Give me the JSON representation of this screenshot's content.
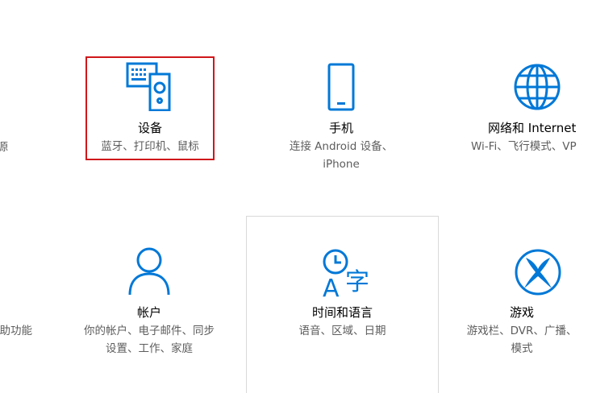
{
  "accent_color": "#0078d7",
  "highlight_color": "#d0171b",
  "tiles": {
    "left_partial_1": {
      "desc_line1": "源"
    },
    "devices": {
      "icon": "devices-icon",
      "title": "设备",
      "desc_line1": "蓝牙、打印机、鼠标"
    },
    "phone": {
      "icon": "phone-icon",
      "title": "手机",
      "desc_line1": "连接 Android 设备、",
      "desc_line2": "iPhone"
    },
    "network": {
      "icon": "globe-icon",
      "title": "网络和 Internet",
      "desc_line1": "Wi-Fi、飞行模式、VP"
    },
    "left_partial_2": {
      "desc_line1": "助功能"
    },
    "accounts": {
      "icon": "person-icon",
      "title": "帐户",
      "desc_line1": "你的帐户、电子邮件、同步",
      "desc_line2": "设置、工作、家庭"
    },
    "time_language": {
      "icon": "time-language-icon",
      "title": "时间和语言",
      "desc_line1": "语音、区域、日期"
    },
    "gaming": {
      "icon": "xbox-icon",
      "title": "游戏",
      "desc_line1": "游戏栏、DVR、广播、",
      "desc_line2": "模式"
    }
  }
}
